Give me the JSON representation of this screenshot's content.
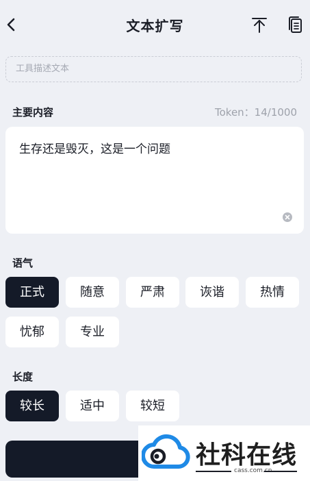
{
  "header": {
    "title": "文本扩写"
  },
  "description": {
    "placeholder": "工具描述文本"
  },
  "main_content": {
    "title": "主要内容",
    "token": "Token：14/1000",
    "text": "生存还是毁灭，这是一个问题"
  },
  "tone": {
    "title": "语气",
    "options": [
      "正式",
      "随意",
      "严肃",
      "诙谐",
      "热情",
      "忧郁",
      "专业"
    ],
    "selected": "正式"
  },
  "length": {
    "title": "长度",
    "options": [
      "较长",
      "适中",
      "较短"
    ],
    "selected": "较长"
  },
  "watermark": {
    "brand": "社科在线",
    "url": "cass.com.cn"
  },
  "colors": {
    "primary": "#141a28",
    "background": "#eef0f5",
    "brand_blue": "#1f8ae6"
  },
  "icons": [
    "back-arrow-icon",
    "pin-top-icon",
    "documents-icon",
    "clear-icon",
    "cloud-eye-logo-icon"
  ]
}
